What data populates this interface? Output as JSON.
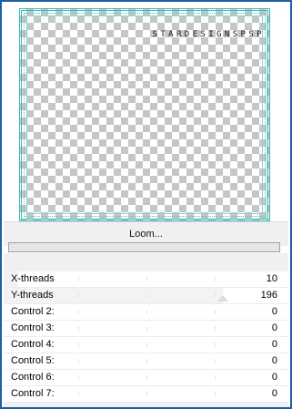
{
  "preview": {
    "watermark": "STARDESIGNSPSP"
  },
  "action": {
    "loom_label": "Loom...",
    "progress_value": 0
  },
  "controls": [
    {
      "label": "X-threads",
      "value": "10",
      "level": 0.05
    },
    {
      "label": "Y-threads",
      "value": "196",
      "level": 0.77
    },
    {
      "label": "Control 2:",
      "value": "0",
      "level": 0
    },
    {
      "label": "Control 3:",
      "value": "0",
      "level": 0
    },
    {
      "label": "Control 4:",
      "value": "0",
      "level": 0
    },
    {
      "label": "Control 5:",
      "value": "0",
      "level": 0
    },
    {
      "label": "Control 6:",
      "value": "0",
      "level": 0
    },
    {
      "label": "Control 7:",
      "value": "0",
      "level": 0
    }
  ],
  "colors": {
    "window_border": "#1c5fa8",
    "preview_frame": "#3bb9b9",
    "progress_fill": "#06b025"
  }
}
